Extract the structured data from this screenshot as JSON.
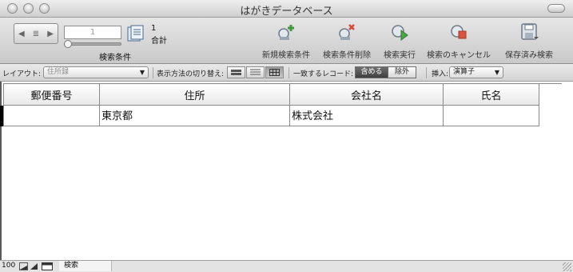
{
  "window": {
    "title": "はがきデータベース"
  },
  "toolbar": {
    "record_field_value": "1",
    "found_count": "1",
    "count_label": "合計",
    "mode_label": "検索条件",
    "buttons": [
      {
        "label": "新規検索条件",
        "icon": "new-find-request-icon"
      },
      {
        "label": "検索条件削除",
        "icon": "delete-find-request-icon"
      },
      {
        "label": "検索実行",
        "icon": "perform-find-icon"
      },
      {
        "label": "検索のキャンセル",
        "icon": "cancel-find-icon"
      },
      {
        "label": "保存済み検索",
        "icon": "saved-finds-icon"
      }
    ]
  },
  "layoutbar": {
    "layout_label": "レイアウト:",
    "layout_value": "住所録",
    "view_as_label": "表示方法の切り替え:",
    "matching_label": "一致するレコード:",
    "include_label": "含める",
    "omit_label": "除外",
    "insert_label": "挿入:",
    "insert_value": "演算子"
  },
  "table": {
    "columns": [
      "郵便番号",
      "住所",
      "会社名",
      "氏名"
    ],
    "rows": [
      [
        "",
        "東京都",
        "株式会社",
        ""
      ]
    ]
  },
  "statusbar": {
    "zoom": "100",
    "mode": "検索"
  }
}
